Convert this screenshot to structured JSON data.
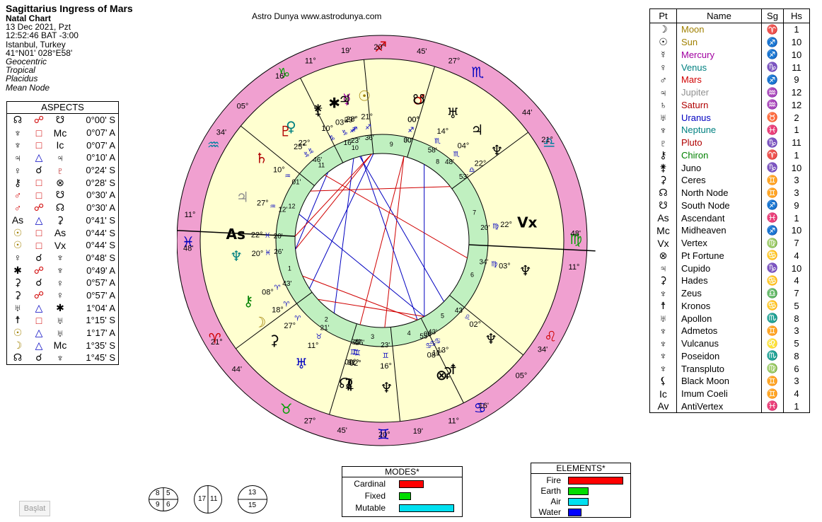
{
  "header": {
    "title": "Sagittarius Ingress of Mars",
    "subtitle": "Natal Chart",
    "date": "13 Dec 2021, Pzt",
    "time": "12:52:46  BAT -3:00",
    "place": "Istanbul, Turkey",
    "coords": "41°N01' 028°E58'",
    "zodiac": "Geocentric",
    "system": "Tropical",
    "houses": "Placidus",
    "node": "Mean Node"
  },
  "site": "Astro Dunya www.astrodunya.com",
  "aspects": {
    "title": "ASPECTS",
    "rows": [
      {
        "p1": "☊",
        "asp": "☍",
        "p2": "☋",
        "val": "0°00' S",
        "c1": "#000",
        "ca": "#d00000",
        "c2": "#000"
      },
      {
        "p1": "♆",
        "asp": "□",
        "p2": "Mc",
        "val": "0°07' A",
        "c1": "#000",
        "ca": "#d00000",
        "c2": "#000"
      },
      {
        "p1": "♆",
        "asp": "□",
        "p2": "Ic",
        "val": "0°07' A",
        "c1": "#000",
        "ca": "#d00000",
        "c2": "#000"
      },
      {
        "p1": "♃",
        "asp": "△",
        "p2": "♃",
        "val": "0°10' A",
        "c1": "#000",
        "ca": "#0000c0",
        "c2": "#000"
      },
      {
        "p1": "♀",
        "asp": "☌",
        "p2": "♇",
        "val": "0°24' S",
        "c1": "#000",
        "ca": "#000",
        "c2": "#b00000"
      },
      {
        "p1": "⚷",
        "asp": "□",
        "p2": "⊗",
        "val": "0°28' S",
        "c1": "#000",
        "ca": "#d00000",
        "c2": "#000"
      },
      {
        "p1": "♂",
        "asp": "□",
        "p2": "☋",
        "val": "0°30' A",
        "c1": "#d00000",
        "ca": "#d00000",
        "c2": "#000"
      },
      {
        "p1": "♂",
        "asp": "☍",
        "p2": "☊",
        "val": "0°30' A",
        "c1": "#d00000",
        "ca": "#d00000",
        "c2": "#000"
      },
      {
        "p1": "As",
        "asp": "△",
        "p2": "⚳",
        "val": "0°41' S",
        "c1": "#000",
        "ca": "#0000c0",
        "c2": "#000"
      },
      {
        "p1": "☉",
        "asp": "□",
        "p2": "As",
        "val": "0°44' S",
        "c1": "#a08000",
        "ca": "#d00000",
        "c2": "#000"
      },
      {
        "p1": "☉",
        "asp": "□",
        "p2": "Vx",
        "val": "0°44' S",
        "c1": "#a08000",
        "ca": "#d00000",
        "c2": "#000"
      },
      {
        "p1": "♀",
        "asp": "☌",
        "p2": "♆",
        "val": "0°48' S",
        "c1": "#000",
        "ca": "#000",
        "c2": "#000"
      },
      {
        "p1": "✱",
        "asp": "☍",
        "p2": "♆",
        "val": "0°49' A",
        "c1": "#000",
        "ca": "#d00000",
        "c2": "#000"
      },
      {
        "p1": "⚳",
        "asp": "☌",
        "p2": "♀",
        "val": "0°57' A",
        "c1": "#000",
        "ca": "#000",
        "c2": "#000"
      },
      {
        "p1": "⚳",
        "asp": "☍",
        "p2": "♀",
        "val": "0°57' A",
        "c1": "#000",
        "ca": "#d00000",
        "c2": "#000"
      },
      {
        "p1": "♅",
        "asp": "△",
        "p2": "✱",
        "val": "1°04' A",
        "c1": "#000",
        "ca": "#0000c0",
        "c2": "#000"
      },
      {
        "p1": "☨",
        "asp": "□",
        "p2": "♅",
        "val": "1°15' S",
        "c1": "#000",
        "ca": "#d00000",
        "c2": "#000"
      },
      {
        "p1": "☉",
        "asp": "△",
        "p2": "♅",
        "val": "1°17' A",
        "c1": "#a08000",
        "ca": "#0000c0",
        "c2": "#000"
      },
      {
        "p1": "☽",
        "asp": "△",
        "p2": "Mc",
        "val": "1°35' S",
        "c1": "#a08000",
        "ca": "#0000c0",
        "c2": "#000"
      },
      {
        "p1": "☊",
        "asp": "☌",
        "p2": "♆",
        "val": "1°45' S",
        "c1": "#000",
        "ca": "#000",
        "c2": "#000"
      }
    ]
  },
  "planets": {
    "headers": [
      "Pt",
      "Name",
      "Sg",
      "Hs"
    ],
    "rows": [
      {
        "g": "☽",
        "name": "Moon",
        "sg": "♈",
        "hs": "1",
        "color": "#a08000"
      },
      {
        "g": "☉",
        "name": "Sun",
        "sg": "♐",
        "hs": "10",
        "color": "#a08000"
      },
      {
        "g": "☿",
        "name": "Mercury",
        "sg": "♐",
        "hs": "10",
        "color": "#a000a0"
      },
      {
        "g": "♀",
        "name": "Venus",
        "sg": "♑",
        "hs": "11",
        "color": "#008080"
      },
      {
        "g": "♂",
        "name": "Mars",
        "sg": "♐",
        "hs": "9",
        "color": "#d00000"
      },
      {
        "g": "♃",
        "name": "Jupiter",
        "sg": "♒",
        "hs": "12",
        "color": "#909090"
      },
      {
        "g": "♄",
        "name": "Saturn",
        "sg": "♒",
        "hs": "12",
        "color": "#b00000"
      },
      {
        "g": "♅",
        "name": "Uranus",
        "sg": "♉",
        "hs": "2",
        "color": "#0000c0"
      },
      {
        "g": "♆",
        "name": "Neptune",
        "sg": "♓",
        "hs": "1",
        "color": "#008080"
      },
      {
        "g": "♇",
        "name": "Pluto",
        "sg": "♑",
        "hs": "11",
        "color": "#b00000"
      },
      {
        "g": "⚷",
        "name": "Chiron",
        "sg": "♈",
        "hs": "1",
        "color": "#008000"
      },
      {
        "g": "⚵",
        "name": "Juno",
        "sg": "♑",
        "hs": "10",
        "color": "#000"
      },
      {
        "g": "⚳",
        "name": "Ceres",
        "sg": "♊",
        "hs": "3",
        "color": "#000"
      },
      {
        "g": "☊",
        "name": "North Node",
        "sg": "♊",
        "hs": "3",
        "color": "#000"
      },
      {
        "g": "☋",
        "name": "South Node",
        "sg": "♐",
        "hs": "9",
        "color": "#000"
      },
      {
        "g": "As",
        "name": "Ascendant",
        "sg": "♓",
        "hs": "1",
        "color": "#000"
      },
      {
        "g": "Mc",
        "name": "Midheaven",
        "sg": "♐",
        "hs": "10",
        "color": "#000"
      },
      {
        "g": "Vx",
        "name": "Vertex",
        "sg": "♍",
        "hs": "7",
        "color": "#000"
      },
      {
        "g": "⊗",
        "name": "Pt Fortune",
        "sg": "♋",
        "hs": "4",
        "color": "#000"
      },
      {
        "g": "♃",
        "name": "Cupido",
        "sg": "♑",
        "hs": "10",
        "color": "#000"
      },
      {
        "g": "⚳",
        "name": "Hades",
        "sg": "♋",
        "hs": "4",
        "color": "#000"
      },
      {
        "g": "♆",
        "name": "Zeus",
        "sg": "♎",
        "hs": "7",
        "color": "#000"
      },
      {
        "g": "☨",
        "name": "Kronos",
        "sg": "♋",
        "hs": "5",
        "color": "#000"
      },
      {
        "g": "♅",
        "name": "Apollon",
        "sg": "♏",
        "hs": "8",
        "color": "#000"
      },
      {
        "g": "♆",
        "name": "Admetos",
        "sg": "♊",
        "hs": "3",
        "color": "#000"
      },
      {
        "g": "♆",
        "name": "Vulcanus",
        "sg": "♌",
        "hs": "5",
        "color": "#000"
      },
      {
        "g": "♆",
        "name": "Poseidon",
        "sg": "♏",
        "hs": "8",
        "color": "#000"
      },
      {
        "g": "♆",
        "name": "Transpluto",
        "sg": "♍",
        "hs": "6",
        "color": "#000"
      },
      {
        "g": "⚸",
        "name": "Black Moon",
        "sg": "♊",
        "hs": "3",
        "color": "#000"
      },
      {
        "g": "Ic",
        "name": "Imum Coeli",
        "sg": "♊",
        "hs": "4",
        "color": "#000"
      },
      {
        "g": "Av",
        "name": "AntiVertex",
        "sg": "♓",
        "hs": "1",
        "color": "#000"
      }
    ]
  },
  "modes": {
    "title": "MODES*",
    "items": [
      {
        "label": "Cardinal",
        "value": 4,
        "color": "#ff0000"
      },
      {
        "label": "Fixed",
        "value": 2,
        "color": "#00dd00"
      },
      {
        "label": "Mutable",
        "value": 9,
        "color": "#00e0f0"
      }
    ]
  },
  "elements": {
    "title": "ELEMENTS*",
    "items": [
      {
        "label": "Fire",
        "value": 8,
        "color": "#ff0000"
      },
      {
        "label": "Earth",
        "value": 3,
        "color": "#00dd00"
      },
      {
        "label": "Air",
        "value": 3,
        "color": "#00e0f0"
      },
      {
        "label": "Water",
        "value": 2,
        "color": "#0000ff"
      }
    ]
  },
  "counts": [
    {
      "cells": [
        "8",
        "5",
        "9",
        "6"
      ]
    },
    {
      "cells": [
        "17",
        "11"
      ]
    },
    {
      "cells": [
        "13",
        "15"
      ]
    }
  ],
  "baslat": "Başlat",
  "chart_data": {
    "type": "wheel",
    "colors": {
      "zodiac_ring": "#f0a0d0",
      "field": "#ffffd0",
      "house_ring": "#c0f0c0"
    },
    "asc_offset": 344.6,
    "signs": [
      {
        "g": "♈",
        "c": "#d00000"
      },
      {
        "g": "♉",
        "c": "#00a000"
      },
      {
        "g": "♊",
        "c": "#0000c0"
      },
      {
        "g": "♋",
        "c": "#0000c0"
      },
      {
        "g": "♌",
        "c": "#d00000"
      },
      {
        "g": "♍",
        "c": "#00a000"
      },
      {
        "g": "♎",
        "c": "#0080a0"
      },
      {
        "g": "♏",
        "c": "#0000c0"
      },
      {
        "g": "♐",
        "c": "#d00000"
      },
      {
        "g": "♑",
        "c": "#00a000"
      },
      {
        "g": "♒",
        "c": "#0080a0"
      },
      {
        "g": "♓",
        "c": "#0000c0"
      }
    ],
    "cusps": [
      {
        "h": 1,
        "lon": 341.8,
        "deg": "11°",
        "min": "48'"
      },
      {
        "h": 2,
        "lon": 21.1,
        "deg": "21°",
        "min": "44'"
      },
      {
        "h": 3,
        "lon": 57.75,
        "deg": "27°",
        "min": "45'"
      },
      {
        "h": 4,
        "lon": 80.3,
        "deg": "20°",
        "min": "19'"
      },
      {
        "h": 5,
        "lon": 101.27,
        "deg": "11°",
        "min": "16'"
      },
      {
        "h": 6,
        "lon": 125.57,
        "deg": "05°",
        "min": "34'"
      },
      {
        "h": 7,
        "lon": 161.8,
        "deg": "11°",
        "min": "48'"
      },
      {
        "h": 8,
        "lon": 201.1,
        "deg": "21°",
        "min": "44'"
      },
      {
        "h": 9,
        "lon": 237.75,
        "deg": "27°",
        "min": "45'"
      },
      {
        "h": 10,
        "lon": 260.3,
        "deg": "20°",
        "min": "19'"
      },
      {
        "h": 11,
        "lon": 281.27,
        "deg": "11°",
        "min": "16'"
      },
      {
        "h": 12,
        "lon": 305.57,
        "deg": "05°",
        "min": "34'"
      }
    ],
    "house_centers": [
      {
        "h": 1,
        "lon": 1.5
      },
      {
        "h": 2,
        "lon": 39.4
      },
      {
        "h": 3,
        "lon": 69
      },
      {
        "h": 4,
        "lon": 90.8
      },
      {
        "h": 5,
        "lon": 113.4
      },
      {
        "h": 6,
        "lon": 143.7
      },
      {
        "h": 7,
        "lon": 181.5
      },
      {
        "h": 8,
        "lon": 219.4
      },
      {
        "h": 9,
        "lon": 249
      },
      {
        "h": 10,
        "lon": 270.8
      },
      {
        "h": 11,
        "lon": 293.4
      },
      {
        "h": 12,
        "lon": 323.7
      }
    ],
    "bodies": [
      {
        "g": "♆",
        "lon": 350.4,
        "deg": "20°",
        "sgn": "♓",
        "min": "26'",
        "r": false,
        "c": "#008080"
      },
      {
        "g": "As",
        "lon": 341.8,
        "deg": "22°",
        "sgn": "♓",
        "min": "20'",
        "r": false,
        "c": "#000"
      },
      {
        "g": "⚷",
        "lon": 8.7,
        "deg": "08°",
        "sgn": "♈",
        "min": "43'",
        "r": true,
        "c": "#008000"
      },
      {
        "g": "⚳",
        "lon": 27.2,
        "deg": "27°",
        "sgn": "♈",
        "min": "",
        "r": true,
        "c": "#000"
      },
      {
        "g": "☽",
        "lon": 18.1,
        "deg": "18°",
        "sgn": "♈",
        "min": "",
        "r": false,
        "c": "#a08000"
      },
      {
        "g": "♅",
        "lon": 41.2,
        "deg": "11°",
        "sgn": "♉",
        "min": "21'",
        "r": true,
        "c": "#0000c0"
      },
      {
        "g": "☊",
        "lon": 60.0,
        "deg": "00°",
        "sgn": "♊",
        "min": "30'",
        "r": true,
        "c": "#000"
      },
      {
        "g": "⚳",
        "lon": 61.27,
        "deg": "01°",
        "sgn": "♊",
        "min": "27'",
        "r": true,
        "c": "#000"
      },
      {
        "g": "⚸",
        "lon": 62.3,
        "deg": "02°",
        "sgn": "♊",
        "min": "16'",
        "r": true,
        "c": "#000"
      },
      {
        "g": "♆",
        "lon": 76.4,
        "deg": "16°",
        "sgn": "♊",
        "min": "23'",
        "r": true,
        "c": "#000"
      },
      {
        "g": "⊗",
        "lon": 98.6,
        "deg": "08°",
        "sgn": "♋",
        "min": "55'",
        "r": false,
        "c": "#000"
      },
      {
        "g": "⚳",
        "lon": 101,
        "deg": "11°",
        "sgn": "♋",
        "min": "06'",
        "r": false,
        "c": "#000"
      },
      {
        "g": "☨",
        "lon": 103.7,
        "deg": "13°",
        "sgn": "♋",
        "min": "43'",
        "r": true,
        "c": "#000"
      },
      {
        "g": "♆",
        "lon": 122.7,
        "deg": "02°",
        "sgn": "♌",
        "min": "43'",
        "r": true,
        "c": "#000"
      },
      {
        "g": "♆",
        "lon": 153,
        "deg": "03°",
        "sgn": "♍",
        "min": "34'",
        "r": true,
        "c": "#000"
      },
      {
        "g": "Vx",
        "lon": 172,
        "deg": "22°",
        "sgn": "♍",
        "min": "20'",
        "r": false,
        "c": "#000"
      },
      {
        "g": "♆",
        "lon": 202.9,
        "deg": "22°",
        "sgn": "♎",
        "min": "53'",
        "r": false,
        "c": "#000"
      },
      {
        "g": "♃",
        "lon": 214.1,
        "deg": "04°",
        "sgn": "♏",
        "min": "48'",
        "r": false,
        "c": "#000"
      },
      {
        "g": "♅",
        "lon": 225.6,
        "deg": "14°",
        "sgn": "♏",
        "min": "58'",
        "r": false,
        "c": "#000"
      },
      {
        "g": "♂",
        "lon": 240,
        "deg": "00°",
        "sgn": "♐",
        "min": "00'",
        "r": false,
        "c": "#d00000"
      },
      {
        "g": "☋",
        "lon": 240,
        "deg": "00°",
        "sgn": "♐",
        "min": "30'",
        "r": true,
        "c": "#000"
      },
      {
        "g": "☉",
        "lon": 261.5,
        "deg": "21°",
        "sgn": "♐",
        "min": "36'",
        "r": false,
        "c": "#a08000"
      },
      {
        "g": "☿",
        "lon": 268.5,
        "deg": "28°",
        "sgn": "♐",
        "min": "",
        "r": false,
        "c": "#a000a0"
      },
      {
        "g": "♃",
        "lon": 269.4,
        "deg": "29°",
        "sgn": "♐",
        "min": "23'",
        "r": false,
        "c": "#000"
      },
      {
        "g": "✱",
        "lon": 273.6,
        "deg": "03°",
        "sgn": "♑",
        "min": "16'",
        "r": false,
        "c": "#000"
      },
      {
        "g": "⚵",
        "lon": 280.5,
        "deg": "10°",
        "sgn": "♑",
        "min": "",
        "r": false,
        "c": "#000"
      },
      {
        "g": "♇",
        "lon": 295.8,
        "deg": "25°",
        "sgn": "♑",
        "min": "",
        "r": false,
        "c": "#b00000"
      },
      {
        "g": "♀",
        "lon": 293,
        "deg": "22°",
        "sgn": "♑",
        "min": "46'",
        "r": true,
        "c": "#008080"
      },
      {
        "g": "♄",
        "lon": 310,
        "deg": "10°",
        "sgn": "♒",
        "min": "01'",
        "r": false,
        "c": "#b00000"
      },
      {
        "g": "♃",
        "lon": 327,
        "deg": "27°",
        "sgn": "♒",
        "min": "12'",
        "r": false,
        "c": "#909090"
      }
    ],
    "aspect_lines": [
      {
        "a": 261.5,
        "b": 350.4,
        "c": "#d00000"
      },
      {
        "a": 240,
        "b": 60,
        "c": "#d00000"
      },
      {
        "a": 240,
        "b": 76.4,
        "c": "#d00000"
      },
      {
        "a": 293,
        "b": 350.4,
        "c": "#0000c0"
      },
      {
        "a": 268.5,
        "b": 98.6,
        "c": "#0000c0"
      },
      {
        "a": 269.4,
        "b": 120,
        "c": "#0000c0"
      },
      {
        "a": 327,
        "b": 103.7,
        "c": "#0000c0"
      },
      {
        "a": 41.2,
        "b": 273.6,
        "c": "#0000c0"
      },
      {
        "a": 18.1,
        "b": 260.3,
        "c": "#0000c0"
      },
      {
        "a": 295.8,
        "b": 153,
        "c": "#d00000"
      },
      {
        "a": 310,
        "b": 202.9,
        "c": "#d00000"
      },
      {
        "a": 8.7,
        "b": 98.6,
        "c": "#d00000"
      },
      {
        "a": 341.8,
        "b": 261.5,
        "c": "#d00000"
      },
      {
        "a": 27.2,
        "b": 103.7,
        "c": "#d00000"
      },
      {
        "a": 225.6,
        "b": 103.7,
        "c": "#0000c0"
      }
    ]
  }
}
